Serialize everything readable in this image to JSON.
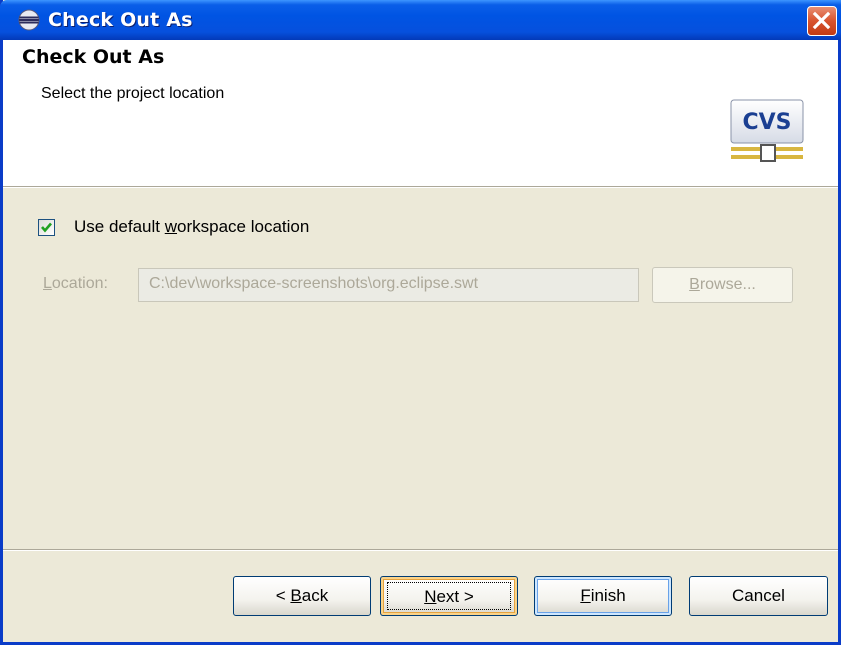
{
  "window": {
    "title": "Check Out As",
    "close_glyph": "✕"
  },
  "header": {
    "title": "Check Out As",
    "subtitle": "Select the project location",
    "logo_text": "CVS"
  },
  "options": {
    "default_location": {
      "label_before": "Use default ",
      "label_mnemonic": "w",
      "label_after": "orkspace location",
      "checked": true
    }
  },
  "location": {
    "label_mnemonic": "L",
    "label_rest": "ocation:",
    "value": "C:\\dev\\workspace-screenshots\\org.eclipse.swt",
    "enabled": false
  },
  "browse": {
    "mnemonic": "B",
    "rest": "rowse...",
    "enabled": false
  },
  "buttons": {
    "back": {
      "before": "< ",
      "mnemonic": "B",
      "after": "ack"
    },
    "next": {
      "mnemonic": "N",
      "after": "ext >"
    },
    "finish": {
      "mnemonic": "F",
      "after": "inish"
    },
    "cancel": {
      "label": "Cancel"
    }
  },
  "colors": {
    "titlebar": "#0054e3",
    "dialog_bg": "#ece9d8",
    "disabled_text": "#aca899",
    "check_mark": "#21a121",
    "close_button": "#d8532e"
  },
  "icons": {
    "title_icon": "eclipse-icon",
    "logo": "cvs-logo-icon",
    "check": "check-mark-icon"
  }
}
